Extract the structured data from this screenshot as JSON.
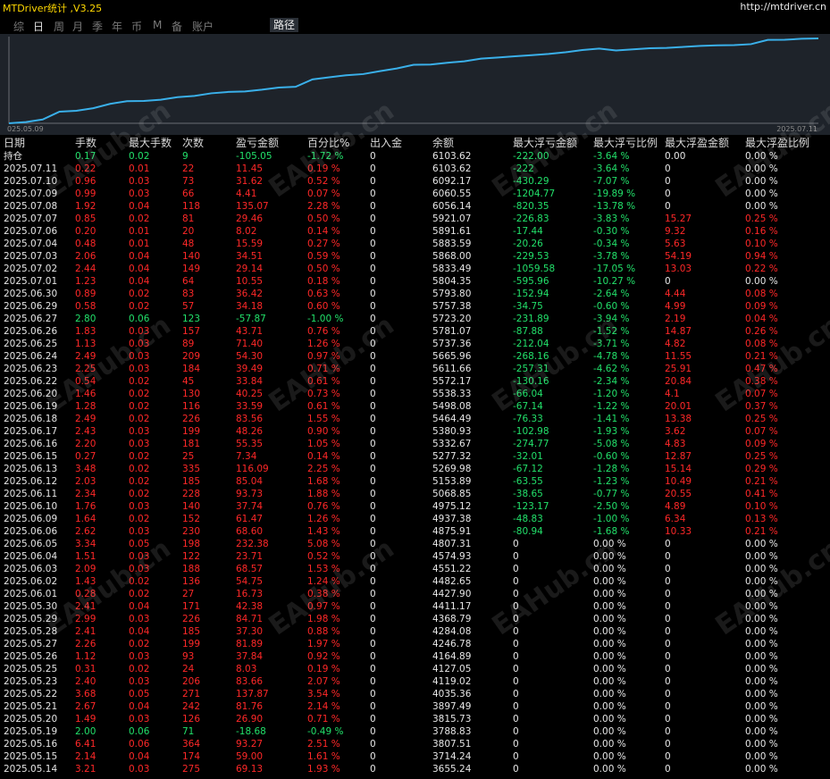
{
  "app": {
    "title": "MTDriver统计 ,V3.25",
    "url": "http://mtdriver.cn"
  },
  "tabs": [
    {
      "label": "综"
    },
    {
      "label": "日"
    },
    {
      "label": "周"
    },
    {
      "label": "月"
    },
    {
      "label": "季"
    },
    {
      "label": "年"
    },
    {
      "label": "币"
    },
    {
      "label": "M"
    },
    {
      "label": "备"
    },
    {
      "label": "账户"
    },
    {
      "label": "路径"
    }
  ],
  "chart_data": {
    "type": "line",
    "x_start_label": "025.05.09",
    "x_end_label": "2025.07.11",
    "line_color": "#3ab0ea",
    "grid": false,
    "values": [
      3420,
      3460,
      3540,
      3788,
      3815,
      3897,
      4035,
      4119,
      4127,
      4164,
      4246,
      4284,
      4368,
      4411,
      4427,
      4482,
      4551,
      4574,
      4807,
      4875,
      4937,
      4975,
      5068,
      5153,
      5269,
      5277,
      5332,
      5380,
      5464,
      5498,
      5538,
      5572,
      5611,
      5665,
      5737,
      5781,
      5723,
      5757,
      5793,
      5804,
      5833,
      5868,
      5883,
      5891,
      5921,
      6056,
      6060,
      6092,
      6103
    ]
  },
  "watermark": "EAHub.cn",
  "table": {
    "headers": [
      "日期",
      "手数",
      "最大手数",
      "次数",
      "盈亏金额",
      "百分比%",
      "出入金",
      "余额",
      "最大浮亏金额",
      "最大浮亏比例",
      "最大浮盈金额",
      "最大浮盈比例"
    ],
    "rows": [
      {
        "c": [
          "持仓",
          "0.17",
          "0.02",
          "9",
          "-105.05",
          "-1.72 %",
          "0",
          "6103.62",
          "-222.00",
          "-3.64 %",
          "0.00",
          "0.00 %"
        ],
        "s": "n"
      },
      {
        "c": [
          "2025.07.11",
          "0.22",
          "0.01",
          "22",
          "11.45",
          "0.19 %",
          "0",
          "6103.62",
          "-222",
          "-3.64 %",
          "0",
          "0.00 %"
        ],
        "s": "p"
      },
      {
        "c": [
          "2025.07.10",
          "0.96",
          "0.03",
          "73",
          "31.62",
          "0.52 %",
          "0",
          "6092.17",
          "-430.29",
          "-7.07 %",
          "0",
          "0.00 %"
        ],
        "s": "p"
      },
      {
        "c": [
          "2025.07.09",
          "0.99",
          "0.03",
          "66",
          "4.41",
          "0.07 %",
          "0",
          "6060.55",
          "-1204.77",
          "-19.89 %",
          "0",
          "0.00 %"
        ],
        "s": "p"
      },
      {
        "c": [
          "2025.07.08",
          "1.92",
          "0.04",
          "118",
          "135.07",
          "2.28 %",
          "0",
          "6056.14",
          "-820.35",
          "-13.78 %",
          "0",
          "0.00 %"
        ],
        "s": "p"
      },
      {
        "c": [
          "2025.07.07",
          "0.85",
          "0.02",
          "81",
          "29.46",
          "0.50 %",
          "0",
          "5921.07",
          "-226.83",
          "-3.83 %",
          "15.27",
          "0.25 %"
        ],
        "s": "p"
      },
      {
        "c": [
          "2025.07.06",
          "0.20",
          "0.01",
          "20",
          "8.02",
          "0.14 %",
          "0",
          "5891.61",
          "-17.44",
          "-0.30 %",
          "9.32",
          "0.16 %"
        ],
        "s": "p"
      },
      {
        "c": [
          "2025.07.04",
          "0.48",
          "0.01",
          "48",
          "15.59",
          "0.27 %",
          "0",
          "5883.59",
          "-20.26",
          "-0.34 %",
          "5.63",
          "0.10 %"
        ],
        "s": "p"
      },
      {
        "c": [
          "2025.07.03",
          "2.06",
          "0.04",
          "140",
          "34.51",
          "0.59 %",
          "0",
          "5868.00",
          "-229.53",
          "-3.78 %",
          "54.19",
          "0.94 %"
        ],
        "s": "p"
      },
      {
        "c": [
          "2025.07.02",
          "2.44",
          "0.04",
          "149",
          "29.14",
          "0.50 %",
          "0",
          "5833.49",
          "-1059.58",
          "-17.05 %",
          "13.03",
          "0.22 %"
        ],
        "s": "p"
      },
      {
        "c": [
          "2025.07.01",
          "1.23",
          "0.04",
          "64",
          "10.55",
          "0.18 %",
          "0",
          "5804.35",
          "-595.96",
          "-10.27 %",
          "0",
          "0.00 %"
        ],
        "s": "p"
      },
      {
        "c": [
          "2025.06.30",
          "0.89",
          "0.02",
          "83",
          "36.42",
          "0.63 %",
          "0",
          "5793.80",
          "-152.94",
          "-2.64 %",
          "4.44",
          "0.08 %"
        ],
        "s": "p"
      },
      {
        "c": [
          "2025.06.29",
          "0.58",
          "0.02",
          "57",
          "34.18",
          "0.60 %",
          "0",
          "5757.38",
          "-34.75",
          "-0.60 %",
          "4.99",
          "0.09 %"
        ],
        "s": "p"
      },
      {
        "c": [
          "2025.06.27",
          "2.80",
          "0.06",
          "123",
          "-57.87",
          "-1.00 %",
          "0",
          "5723.20",
          "-231.89",
          "-3.94 %",
          "2.19",
          "0.04 %"
        ],
        "s": "n"
      },
      {
        "c": [
          "2025.06.26",
          "1.83",
          "0.03",
          "157",
          "43.71",
          "0.76 %",
          "0",
          "5781.07",
          "-87.88",
          "-1.52 %",
          "14.87",
          "0.26 %"
        ],
        "s": "p"
      },
      {
        "c": [
          "2025.06.25",
          "1.13",
          "0.03",
          "89",
          "71.40",
          "1.26 %",
          "0",
          "5737.36",
          "-212.04",
          "-3.71 %",
          "4.82",
          "0.08 %"
        ],
        "s": "p"
      },
      {
        "c": [
          "2025.06.24",
          "2.49",
          "0.03",
          "209",
          "54.30",
          "0.97 %",
          "0",
          "5665.96",
          "-268.16",
          "-4.78 %",
          "11.55",
          "0.21 %"
        ],
        "s": "p"
      },
      {
        "c": [
          "2025.06.23",
          "2.25",
          "0.03",
          "184",
          "39.49",
          "0.71 %",
          "0",
          "5611.66",
          "-257.31",
          "-4.62 %",
          "25.91",
          "0.47 %"
        ],
        "s": "p"
      },
      {
        "c": [
          "2025.06.22",
          "0.54",
          "0.02",
          "45",
          "33.84",
          "0.61 %",
          "0",
          "5572.17",
          "-130.16",
          "-2.34 %",
          "20.84",
          "0.38 %"
        ],
        "s": "p"
      },
      {
        "c": [
          "2025.06.20",
          "1.46",
          "0.02",
          "130",
          "40.25",
          "0.73 %",
          "0",
          "5538.33",
          "-66.04",
          "-1.20 %",
          "4.1",
          "0.07 %"
        ],
        "s": "p"
      },
      {
        "c": [
          "2025.06.19",
          "1.28",
          "0.02",
          "116",
          "33.59",
          "0.61 %",
          "0",
          "5498.08",
          "-67.14",
          "-1.22 %",
          "20.01",
          "0.37 %"
        ],
        "s": "p"
      },
      {
        "c": [
          "2025.06.18",
          "2.49",
          "0.02",
          "226",
          "83.56",
          "1.55 %",
          "0",
          "5464.49",
          "-76.33",
          "-1.41 %",
          "13.38",
          "0.25 %"
        ],
        "s": "p"
      },
      {
        "c": [
          "2025.06.17",
          "2.43",
          "0.03",
          "199",
          "48.26",
          "0.90 %",
          "0",
          "5380.93",
          "-102.98",
          "-1.93 %",
          "3.62",
          "0.07 %"
        ],
        "s": "p"
      },
      {
        "c": [
          "2025.06.16",
          "2.20",
          "0.03",
          "181",
          "55.35",
          "1.05 %",
          "0",
          "5332.67",
          "-274.77",
          "-5.08 %",
          "4.83",
          "0.09 %"
        ],
        "s": "p"
      },
      {
        "c": [
          "2025.06.15",
          "0.27",
          "0.02",
          "25",
          "7.34",
          "0.14 %",
          "0",
          "5277.32",
          "-32.01",
          "-0.60 %",
          "12.87",
          "0.25 %"
        ],
        "s": "p"
      },
      {
        "c": [
          "2025.06.13",
          "3.48",
          "0.02",
          "335",
          "116.09",
          "2.25 %",
          "0",
          "5269.98",
          "-67.12",
          "-1.28 %",
          "15.14",
          "0.29 %"
        ],
        "s": "p"
      },
      {
        "c": [
          "2025.06.12",
          "2.03",
          "0.02",
          "185",
          "85.04",
          "1.68 %",
          "0",
          "5153.89",
          "-63.55",
          "-1.23 %",
          "10.49",
          "0.21 %"
        ],
        "s": "p"
      },
      {
        "c": [
          "2025.06.11",
          "2.34",
          "0.02",
          "228",
          "93.73",
          "1.88 %",
          "0",
          "5068.85",
          "-38.65",
          "-0.77 %",
          "20.55",
          "0.41 %"
        ],
        "s": "p"
      },
      {
        "c": [
          "2025.06.10",
          "1.76",
          "0.03",
          "140",
          "37.74",
          "0.76 %",
          "0",
          "4975.12",
          "-123.17",
          "-2.50 %",
          "4.89",
          "0.10 %"
        ],
        "s": "p"
      },
      {
        "c": [
          "2025.06.09",
          "1.64",
          "0.02",
          "152",
          "61.47",
          "1.26 %",
          "0",
          "4937.38",
          "-48.83",
          "-1.00 %",
          "6.34",
          "0.13 %"
        ],
        "s": "p"
      },
      {
        "c": [
          "2025.06.06",
          "2.62",
          "0.03",
          "230",
          "68.60",
          "1.43 %",
          "0",
          "4875.91",
          "-80.94",
          "-1.68 %",
          "10.33",
          "0.21 %"
        ],
        "s": "p"
      },
      {
        "c": [
          "2025.06.05",
          "3.34",
          "0.05",
          "198",
          "232.38",
          "5.08 %",
          "0",
          "4807.31",
          "0",
          "0.00 %",
          "0",
          "0.00 %"
        ],
        "s": "p"
      },
      {
        "c": [
          "2025.06.04",
          "1.51",
          "0.03",
          "122",
          "23.71",
          "0.52 %",
          "0",
          "4574.93",
          "0",
          "0.00 %",
          "0",
          "0.00 %"
        ],
        "s": "p"
      },
      {
        "c": [
          "2025.06.03",
          "2.09",
          "0.03",
          "188",
          "68.57",
          "1.53 %",
          "0",
          "4551.22",
          "0",
          "0.00 %",
          "0",
          "0.00 %"
        ],
        "s": "p"
      },
      {
        "c": [
          "2025.06.02",
          "1.43",
          "0.02",
          "136",
          "54.75",
          "1.24 %",
          "0",
          "4482.65",
          "0",
          "0.00 %",
          "0",
          "0.00 %"
        ],
        "s": "p"
      },
      {
        "c": [
          "2025.06.01",
          "0.28",
          "0.02",
          "27",
          "16.73",
          "0.38 %",
          "0",
          "4427.90",
          "0",
          "0.00 %",
          "0",
          "0.00 %"
        ],
        "s": "p"
      },
      {
        "c": [
          "2025.05.30",
          "2.41",
          "0.04",
          "171",
          "42.38",
          "0.97 %",
          "0",
          "4411.17",
          "0",
          "0.00 %",
          "0",
          "0.00 %"
        ],
        "s": "p"
      },
      {
        "c": [
          "2025.05.29",
          "2.99",
          "0.03",
          "226",
          "84.71",
          "1.98 %",
          "0",
          "4368.79",
          "0",
          "0.00 %",
          "0",
          "0.00 %"
        ],
        "s": "p"
      },
      {
        "c": [
          "2025.05.28",
          "2.41",
          "0.04",
          "185",
          "37.30",
          "0.88 %",
          "0",
          "4284.08",
          "0",
          "0.00 %",
          "0",
          "0.00 %"
        ],
        "s": "p"
      },
      {
        "c": [
          "2025.05.27",
          "2.26",
          "0.02",
          "199",
          "81.89",
          "1.97 %",
          "0",
          "4246.78",
          "0",
          "0.00 %",
          "0",
          "0.00 %"
        ],
        "s": "p"
      },
      {
        "c": [
          "2025.05.26",
          "1.12",
          "0.03",
          "93",
          "37.84",
          "0.92 %",
          "0",
          "4164.89",
          "0",
          "0.00 %",
          "0",
          "0.00 %"
        ],
        "s": "p"
      },
      {
        "c": [
          "2025.05.25",
          "0.31",
          "0.02",
          "24",
          "8.03",
          "0.19 %",
          "0",
          "4127.05",
          "0",
          "0.00 %",
          "0",
          "0.00 %"
        ],
        "s": "p"
      },
      {
        "c": [
          "2025.05.23",
          "2.40",
          "0.03",
          "206",
          "83.66",
          "2.07 %",
          "0",
          "4119.02",
          "0",
          "0.00 %",
          "0",
          "0.00 %"
        ],
        "s": "p"
      },
      {
        "c": [
          "2025.05.22",
          "3.68",
          "0.05",
          "271",
          "137.87",
          "3.54 %",
          "0",
          "4035.36",
          "0",
          "0.00 %",
          "0",
          "0.00 %"
        ],
        "s": "p"
      },
      {
        "c": [
          "2025.05.21",
          "2.67",
          "0.04",
          "242",
          "81.76",
          "2.14 %",
          "0",
          "3897.49",
          "0",
          "0.00 %",
          "0",
          "0.00 %"
        ],
        "s": "p"
      },
      {
        "c": [
          "2025.05.20",
          "1.49",
          "0.03",
          "126",
          "26.90",
          "0.71 %",
          "0",
          "3815.73",
          "0",
          "0.00 %",
          "0",
          "0.00 %"
        ],
        "s": "p"
      },
      {
        "c": [
          "2025.05.19",
          "2.00",
          "0.06",
          "71",
          "-18.68",
          "-0.49 %",
          "0",
          "3788.83",
          "0",
          "0.00 %",
          "0",
          "0.00 %"
        ],
        "s": "n"
      },
      {
        "c": [
          "2025.05.16",
          "6.41",
          "0.06",
          "364",
          "93.27",
          "2.51 %",
          "0",
          "3807.51",
          "0",
          "0.00 %",
          "0",
          "0.00 %"
        ],
        "s": "p"
      },
      {
        "c": [
          "2025.05.15",
          "2.14",
          "0.04",
          "174",
          "59.00",
          "1.61 %",
          "0",
          "3714.24",
          "0",
          "0.00 %",
          "0",
          "0.00 %"
        ],
        "s": "p"
      },
      {
        "c": [
          "2025.05.14",
          "3.21",
          "0.03",
          "275",
          "69.13",
          "1.93 %",
          "0",
          "3655.24",
          "0",
          "0.00 %",
          "0",
          "0.00 %"
        ],
        "s": "p"
      }
    ]
  }
}
